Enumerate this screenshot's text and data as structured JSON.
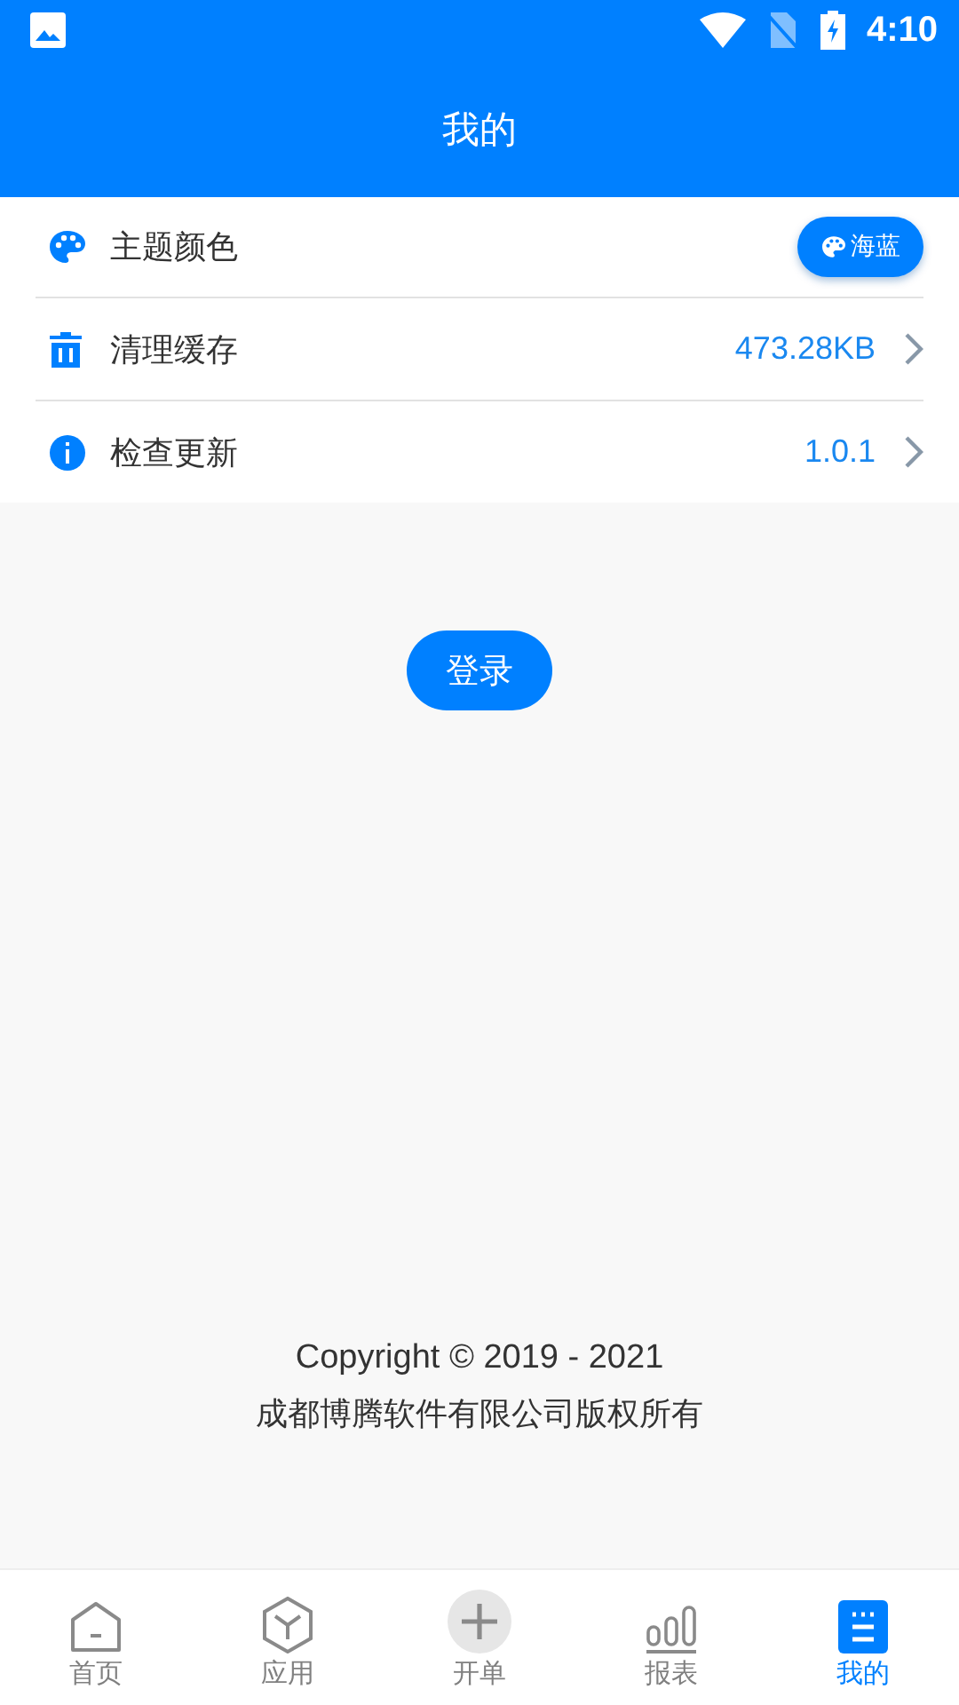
{
  "status_bar": {
    "time": "4:10"
  },
  "header": {
    "title": "我的"
  },
  "settings": [
    {
      "kind": "theme",
      "label": "主题颜色",
      "badge": "海蓝"
    },
    {
      "kind": "value",
      "label": "清理缓存",
      "value": "473.28KB"
    },
    {
      "kind": "value",
      "label": "检查更新",
      "value": "1.0.1"
    }
  ],
  "login_button": "登录",
  "footer": {
    "copyright": "Copyright © 2019 - 2021",
    "company": "成都博腾软件有限公司版权所有"
  },
  "tabs": [
    {
      "label": "首页",
      "selected": false
    },
    {
      "label": "应用",
      "selected": false
    },
    {
      "label": "开单",
      "selected": false
    },
    {
      "label": "报表",
      "selected": false
    },
    {
      "label": "我的",
      "selected": true
    }
  ]
}
